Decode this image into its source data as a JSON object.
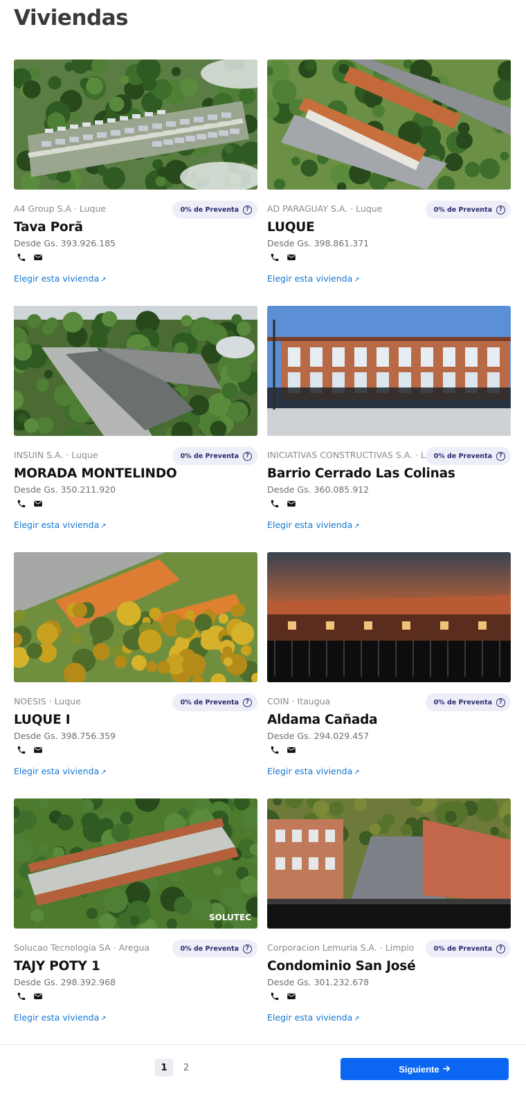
{
  "page": {
    "title": "Viviendas"
  },
  "cards": [
    {
      "developer_location": "A4 Group S.A · Luque",
      "name": "Tava Porã",
      "price": "Desde Gs. 393.926.185",
      "badge": "0% de Preventa",
      "cta": "Elegir esta vivienda",
      "cta_icon": "arrow-up-right-icon"
    },
    {
      "developer_location": "AD PARAGUAY S.A. · Luque",
      "name": "LUQUE",
      "price": "Desde Gs. 398.861.371",
      "badge": "0% de Preventa",
      "cta": "Elegir esta vivienda",
      "cta_icon": "arrow-up-right-icon"
    },
    {
      "developer_location": "INSUIN S.A. · Luque",
      "name": "MORADA MONTELINDO",
      "price": "Desde Gs. 350.211.920",
      "badge": "0% de Preventa",
      "cta": "Elegir esta vivienda",
      "cta_icon": "arrow-up-right-icon"
    },
    {
      "developer_location": "INICIATIVAS CONSTRUCTIVAS S.A. · Luque",
      "name": "Barrio Cerrado Las Colinas",
      "price": "Desde Gs. 360.085.912",
      "badge": "0% de Preventa",
      "cta": "Elegir esta vivienda",
      "cta_icon": "arrow-up-right-icon"
    },
    {
      "developer_location": "NOESIS · Luque",
      "name": "LUQUE I",
      "price": "Desde Gs. 398.756.359",
      "badge": "0% de Preventa",
      "cta": "Elegir esta vivienda",
      "cta_icon": "arrow-up-right-icon"
    },
    {
      "developer_location": "COIN · Itaugua",
      "name": "Aldama Cañada",
      "price": "Desde Gs. 294.029.457",
      "badge": "0% de Preventa",
      "cta": "Elegir esta vivienda",
      "cta_icon": "arrow-up-right-icon"
    },
    {
      "developer_location": "Solucao Tecnologia SA · Aregua",
      "name": "TAJY POTY 1",
      "price": "Desde Gs. 298.392.968",
      "badge": "0% de Preventa",
      "cta": "Elegir esta vivienda",
      "cta_icon": "arrow-up-right-icon",
      "image_watermark": "SOLUTEC"
    },
    {
      "developer_location": "Corporacion Lemuria S.A. · Limpio",
      "name": "Condominio San José",
      "price": "Desde Gs. 301.232.678",
      "badge": "0% de Preventa",
      "cta": "Elegir esta vivienda",
      "cta_icon": "arrow-up-right-icon"
    }
  ],
  "pagination": {
    "pages": [
      "1",
      "2"
    ],
    "current": "1",
    "next_label": "Siguiente",
    "next_icon": "arrow-right-icon"
  },
  "icons": {
    "phone": "phone-icon",
    "email": "envelope-icon",
    "badge_help": "question-circle-icon"
  },
  "colors": {
    "link": "#1677d2",
    "primary_button": "#0b66f2",
    "badge_bg": "#eeeef9",
    "badge_text": "#2b2d6e"
  }
}
